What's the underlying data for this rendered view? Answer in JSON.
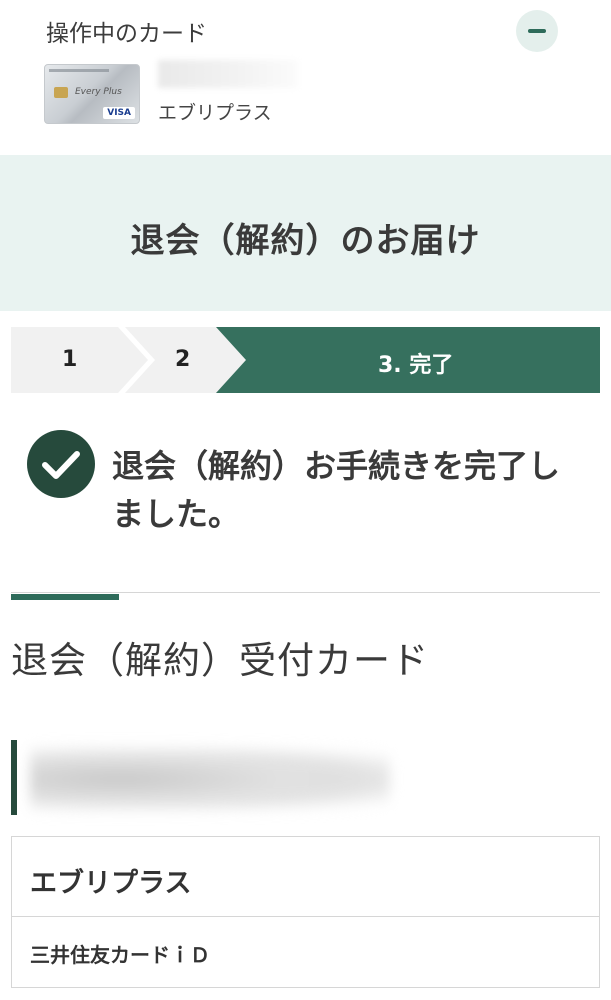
{
  "header": {
    "label": "操作中のカード",
    "card_name": "エブリプラス",
    "card_brand": "VISA",
    "card_scribble": "Every Plus"
  },
  "banner": {
    "title": "退会（解約）のお届け"
  },
  "steps": [
    {
      "label": "1",
      "state": "done"
    },
    {
      "label": "2",
      "state": "done"
    },
    {
      "label": "3. 完了",
      "state": "current"
    }
  ],
  "completion": {
    "message": "退会（解約）お手続きを完了しました。"
  },
  "section": {
    "title": "退会（解約）受付カード"
  },
  "card_table": {
    "name": "エブリプラス",
    "type": "三井住友カードｉＤ"
  },
  "colors": {
    "accent": "#2e6b5a",
    "accent_dark": "#264a3c",
    "banner_bg": "#e9f3f1",
    "step_inactive": "#f1f1f1"
  }
}
